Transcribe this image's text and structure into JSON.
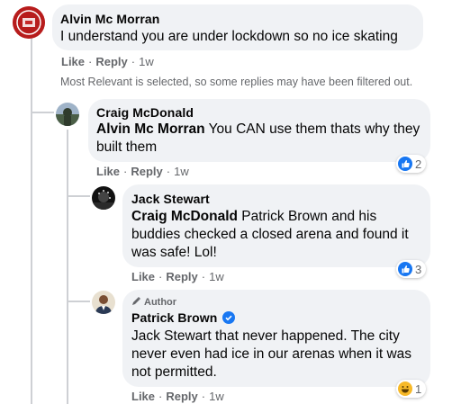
{
  "comments": [
    {
      "author": "Alvin Mc Morran",
      "text": "I understand you are under lockdown so no ice skating",
      "like": "Like",
      "reply": "Reply",
      "time": "1w"
    },
    {
      "author": "Craig McDonald",
      "mention": "Alvin Mc Morran",
      "text": " You CAN use them thats why they built them",
      "like": "Like",
      "reply": "Reply",
      "time": "1w",
      "reaction": {
        "icon": "like-reaction-icon",
        "count": "2",
        "color": "#1877f2"
      }
    },
    {
      "author": "Jack Stewart",
      "mention": "Craig McDonald",
      "text": " Patrick Brown and his buddies checked a closed arena and found it was safe! Lol!",
      "like": "Like",
      "reply": "Reply",
      "time": "1w",
      "reaction": {
        "icon": "like-reaction-icon",
        "count": "3",
        "color": "#1877f2"
      }
    },
    {
      "badge": "Author",
      "author": "Patrick Brown",
      "verified_icon": "verified-badge-icon",
      "text": "Jack Stewart that never happened. The city never even had ice in our arenas when it was not permitted.",
      "like": "Like",
      "reply": "Reply",
      "time": "1w",
      "reaction": {
        "icon": "haha-reaction-icon",
        "count": "1",
        "color": "#f7b928"
      }
    }
  ],
  "notice": "Most Relevant is selected, so some replies may have been filtered out."
}
